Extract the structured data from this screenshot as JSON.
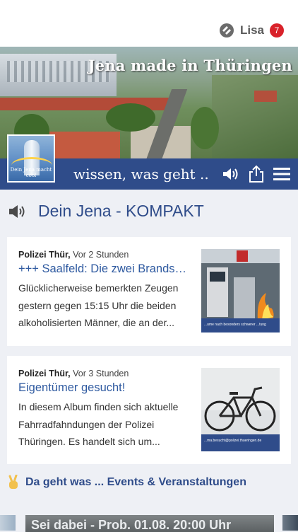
{
  "user": {
    "name": "Lisa",
    "notifications": "7"
  },
  "banner": {
    "title": "Jena made in Thüringen",
    "logo_text": "Dein Jena macht cool",
    "tagline": "wissen, was geht .."
  },
  "section": {
    "title": "Dein Jena - KOMPAKT"
  },
  "news": [
    {
      "source": "Polizei Thür,",
      "time": "Vor 2 Stunden",
      "headline": "+++ Saalfeld: Die zwei Brandstift...",
      "excerpt": "Glücklicherweise bemerkten Zeugen gestern gegen 15:15 Uhr die beiden alkoholisierten Männer, die an der...",
      "image_caption": "...ume nach besonders schwerer ...tung"
    },
    {
      "source": "Polizei Thür,",
      "time": "Vor 3 Stunden",
      "headline": "Eigentümer gesucht!",
      "excerpt": "In diesem Album finden sich aktuelle Fahrradfahndungen der Polizei Thüringen. Es handelt sich um...",
      "image_caption": "...ma.besucht@polizei.thueringen.de"
    }
  ],
  "events": {
    "title": "Da geht was ... Events & Veranstaltungen",
    "strip_text": "Sei dabei - Prob. 01.08. 20:00 Uhr"
  },
  "colors": {
    "brand_blue": "#2f4c8a",
    "link_blue": "#2f5aa0",
    "badge_red": "#d9222a"
  }
}
